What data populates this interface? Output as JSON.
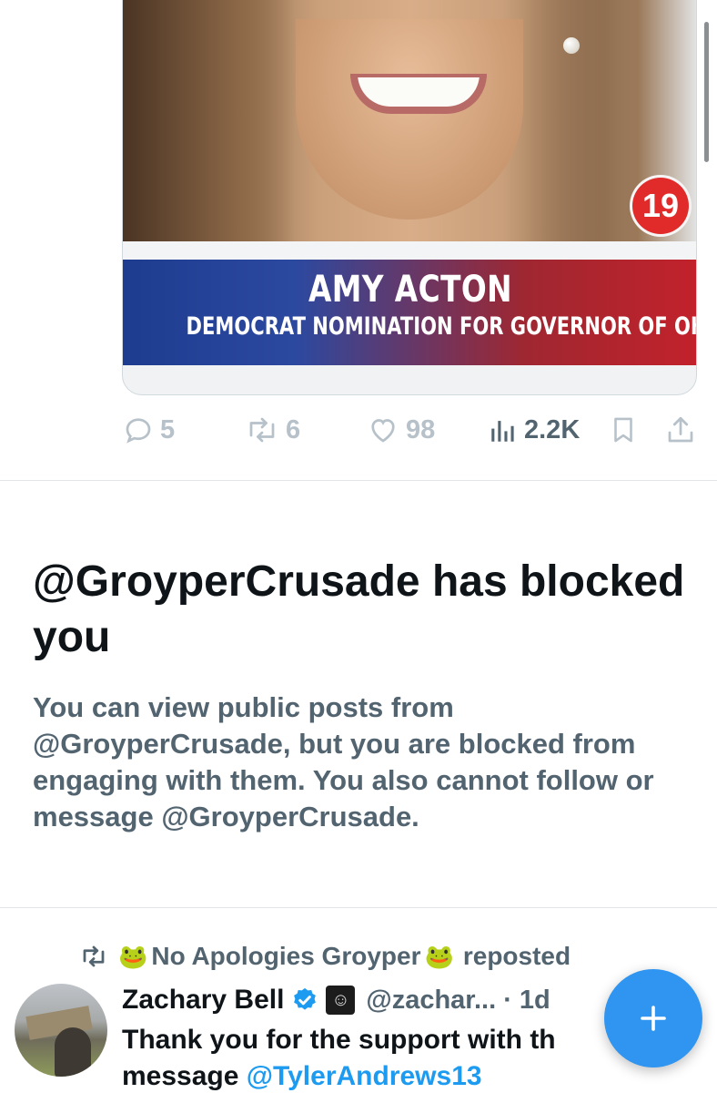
{
  "media": {
    "channel_number": "19",
    "lower_third_name": "AMY ACTON",
    "lower_third_subtitle": "DEMOCRAT NOMINATION FOR GOVERNOR OF OHIO"
  },
  "actions": {
    "replies": "5",
    "reposts": "6",
    "likes": "98",
    "views": "2.2K"
  },
  "blocked": {
    "title": "@GroyperCrusade has blocked you",
    "description": "You can view public posts from @GroyperCrusade, but you are blocked from engaging with them. You also cannot follow or message @GroyperCrusade."
  },
  "next_tweet": {
    "reposted_by": "No Apologies Groyper",
    "reposted_suffix": "reposted",
    "author_name": "Zachary Bell",
    "handle_time": "@zachar... · 1d",
    "text_line1": "Thank you for the support with th",
    "text_line2_prefix": "message ",
    "text_line2_mention": "@TylerAndrews13"
  },
  "colors": {
    "accent": "#1d9bf0",
    "fab": "#2f95f0",
    "secondary_text": "#536471"
  },
  "icons": [
    "reply-icon",
    "repost-icon",
    "like-icon",
    "views-icon",
    "bookmark-icon",
    "share-icon",
    "verified-badge-icon",
    "plus-icon"
  ]
}
